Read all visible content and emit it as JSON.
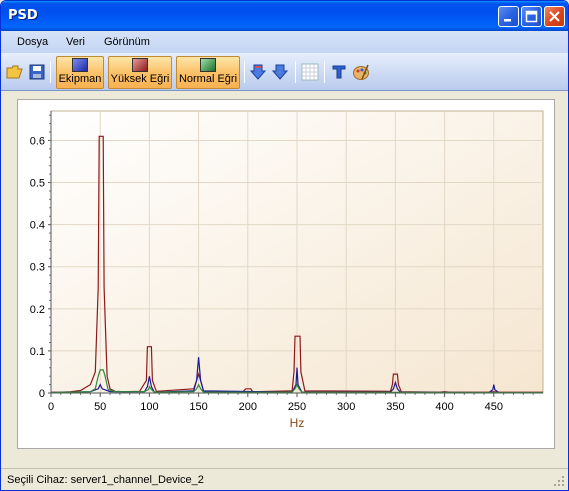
{
  "window": {
    "title": "PSD"
  },
  "menu": {
    "items": [
      "Dosya",
      "Veri",
      "Görünüm"
    ]
  },
  "toolbar": {
    "buttons": [
      {
        "label": "Ekipman",
        "color": "#2233aa"
      },
      {
        "label": "Yüksek Eğri",
        "color": "#a52a2a"
      },
      {
        "label": "Normal Eğri",
        "color": "#2e8b3a"
      }
    ],
    "icons": [
      "open-folder-icon",
      "save-icon",
      "move-down-icon",
      "move-down-alt-icon",
      "grid-icon",
      "text-format-icon",
      "palette-icon"
    ]
  },
  "chart_data": {
    "type": "line",
    "xlabel": "Hz",
    "ylabel": "",
    "xlim": [
      0,
      500
    ],
    "ylim": [
      0,
      0.67
    ],
    "xticks": [
      0,
      50,
      100,
      150,
      200,
      250,
      300,
      350,
      400,
      450
    ],
    "yticks": [
      0,
      0.1,
      0.2,
      0.3,
      0.4,
      0.5,
      0.6
    ],
    "ytick_labels": [
      "0",
      "0.1",
      "0.2",
      "0.3",
      "0.4",
      "0.5",
      "0.6"
    ],
    "grid": true,
    "series": [
      {
        "color": "#8b1a1a",
        "x": [
          0,
          10,
          20,
          30,
          40,
          45,
          48,
          49,
          50,
          53,
          54,
          57,
          60,
          65,
          75,
          90,
          97,
          98,
          102,
          103,
          107,
          145,
          148,
          150,
          152,
          155,
          195,
          198,
          203,
          205,
          245,
          247,
          248,
          253,
          254,
          258,
          345,
          347,
          348,
          352,
          353,
          356,
          395,
          400,
          405,
          445,
          450,
          455,
          500
        ],
        "y": [
          0.002,
          0.002,
          0.003,
          0.006,
          0.02,
          0.05,
          0.25,
          0.61,
          0.61,
          0.61,
          0.25,
          0.04,
          0.01,
          0.004,
          0.003,
          0.004,
          0.03,
          0.11,
          0.11,
          0.03,
          0.004,
          0.01,
          0.03,
          0.045,
          0.03,
          0.004,
          0.003,
          0.01,
          0.01,
          0.003,
          0.005,
          0.05,
          0.135,
          0.135,
          0.05,
          0.005,
          0.004,
          0.02,
          0.045,
          0.045,
          0.02,
          0.003,
          0.002,
          0.003,
          0.002,
          0.002,
          0.003,
          0.002,
          0.002
        ]
      },
      {
        "color": "#1a1a99",
        "x": [
          0,
          40,
          48,
          50,
          52,
          60,
          95,
          98,
          100,
          102,
          105,
          145,
          148,
          150,
          152,
          155,
          245,
          249,
          250,
          251,
          255,
          345,
          348,
          350,
          352,
          355,
          445,
          449,
          450,
          451,
          455,
          500
        ],
        "y": [
          0.001,
          0.003,
          0.01,
          0.02,
          0.01,
          0.003,
          0.003,
          0.015,
          0.04,
          0.015,
          0.002,
          0.005,
          0.03,
          0.085,
          0.03,
          0.005,
          0.002,
          0.02,
          0.06,
          0.02,
          0.002,
          0.002,
          0.01,
          0.025,
          0.01,
          0.002,
          0.001,
          0.008,
          0.02,
          0.008,
          0.001,
          0.001
        ]
      },
      {
        "color": "#2e8b3a",
        "x": [
          0,
          40,
          45,
          48,
          50,
          53,
          55,
          58,
          65,
          95,
          99,
          100,
          102,
          105,
          145,
          148,
          150,
          152,
          155,
          245,
          248,
          250,
          252,
          255,
          500
        ],
        "y": [
          0.001,
          0.003,
          0.01,
          0.04,
          0.055,
          0.055,
          0.04,
          0.008,
          0.003,
          0.003,
          0.008,
          0.015,
          0.008,
          0.002,
          0.003,
          0.01,
          0.02,
          0.01,
          0.002,
          0.002,
          0.01,
          0.02,
          0.01,
          0.002,
          0.001
        ]
      }
    ]
  },
  "status": {
    "text": "Seçili Cihaz: server1_channel_Device_2"
  }
}
